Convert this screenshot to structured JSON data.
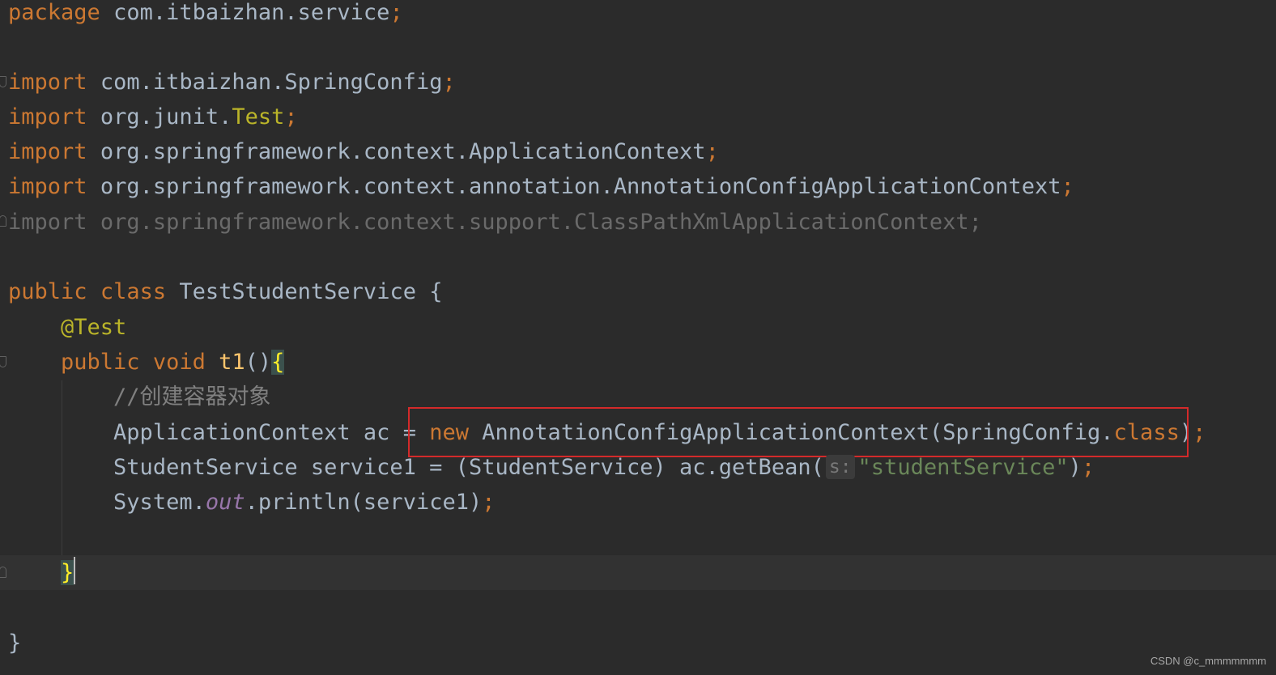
{
  "code": {
    "line1": {
      "kw": "package",
      "path": "com.itbaizhan.service",
      "semi": ";"
    },
    "imports": [
      {
        "kw": "import",
        "path": "com.itbaizhan.SpringConfig",
        "semi": ";"
      },
      {
        "kw": "import",
        "path": "org.junit.",
        "cls": "Test",
        "semi": ";"
      },
      {
        "kw": "import",
        "path": "org.springframework.context.ApplicationContext",
        "semi": ";"
      },
      {
        "kw": "import",
        "path": "org.springframework.context.annotation.AnnotationConfigApplicationContext",
        "semi": ";"
      },
      {
        "kw": "import",
        "path": "org.springframework.context.support.ClassPathXmlApplicationContext",
        "semi": ";"
      }
    ],
    "class_decl": {
      "public": "public",
      "class": "class",
      "name": "TestStudentService",
      "brace": "{"
    },
    "annotation": "@Test",
    "method_decl": {
      "public": "public",
      "void": "void",
      "name": "t1",
      "parens": "()",
      "brace": "{"
    },
    "comment": "//创建容器对象",
    "line_ac": {
      "type": "ApplicationContext",
      "var": "ac",
      "eq": "=",
      "new_kw": "new",
      "ctor": "AnnotationConfigApplicationContext(SpringConfig.",
      "class_kw": "class",
      "close": ")",
      "semi": ";"
    },
    "line_service": {
      "decl": "StudentService service1 = (StudentService) ac.getBean(",
      "hint": "s:",
      "str": "\"studentService\"",
      "close": ")",
      "semi": ";"
    },
    "line_print": {
      "sys": "System.",
      "out": "out",
      "rest": ".println(service1)",
      "semi": ";"
    },
    "method_close": "}",
    "class_close": "}"
  },
  "watermark": "CSDN @c_mmmmmmm",
  "colors": {
    "background": "#2b2b2b",
    "keyword": "#cc7832",
    "identifier": "#a9b7c6",
    "annotation": "#bbb529",
    "method": "#ffc66d",
    "string": "#6a8759",
    "comment": "#808080",
    "highlight_box": "#d42a2a"
  }
}
